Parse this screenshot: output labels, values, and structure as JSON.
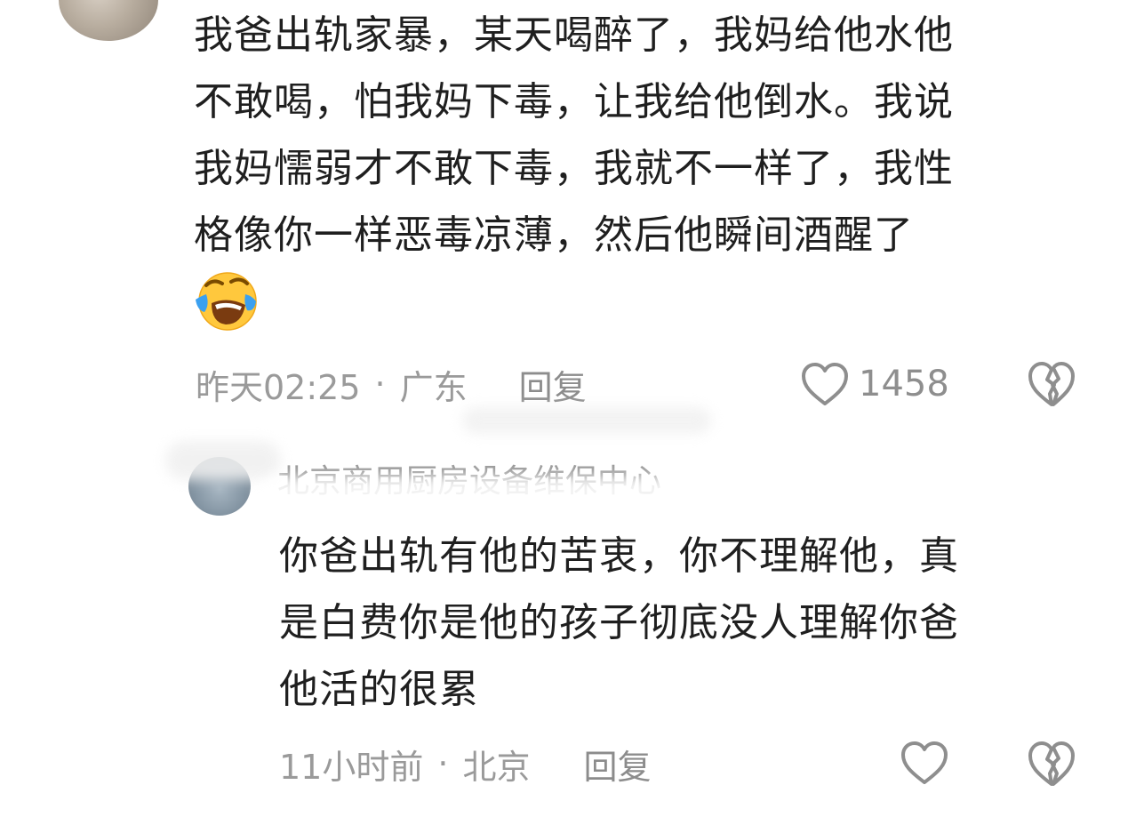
{
  "comments": [
    {
      "text_lines": [
        "我爸出轨家暴，某天喝醉了，我妈给他水他",
        "不敢喝，怕我妈下毒，让我给他倒水。我说",
        "我妈懦弱才不敢下毒，我就不一样了，我性",
        "格像你一样恶毒凉薄，然后他瞬间酒醒了"
      ],
      "emoji": "tears-of-joy-emoji",
      "time": "昨天02:25",
      "separator": "·",
      "location": "广东",
      "reply_label": "回复",
      "like_count": "1458"
    },
    {
      "username": "北京商用厨房设备维保中心",
      "text_lines": [
        "你爸出轨有他的苦衷，你不理解他，真",
        "是白费你是他的孩子彻底没人理解你爸",
        "他活的很累"
      ],
      "time": "11小时前",
      "separator": "·",
      "location": "北京",
      "reply_label": "回复"
    }
  ],
  "icons": {
    "like": "heart-outline-icon",
    "dislike": "broken-heart-icon"
  },
  "colors": {
    "text": "#1f1f1f",
    "meta": "#9a9a9a",
    "icon": "#8e8e8e",
    "emoji_face": "#ffc83d",
    "emoji_tears": "#3aa0f0"
  }
}
